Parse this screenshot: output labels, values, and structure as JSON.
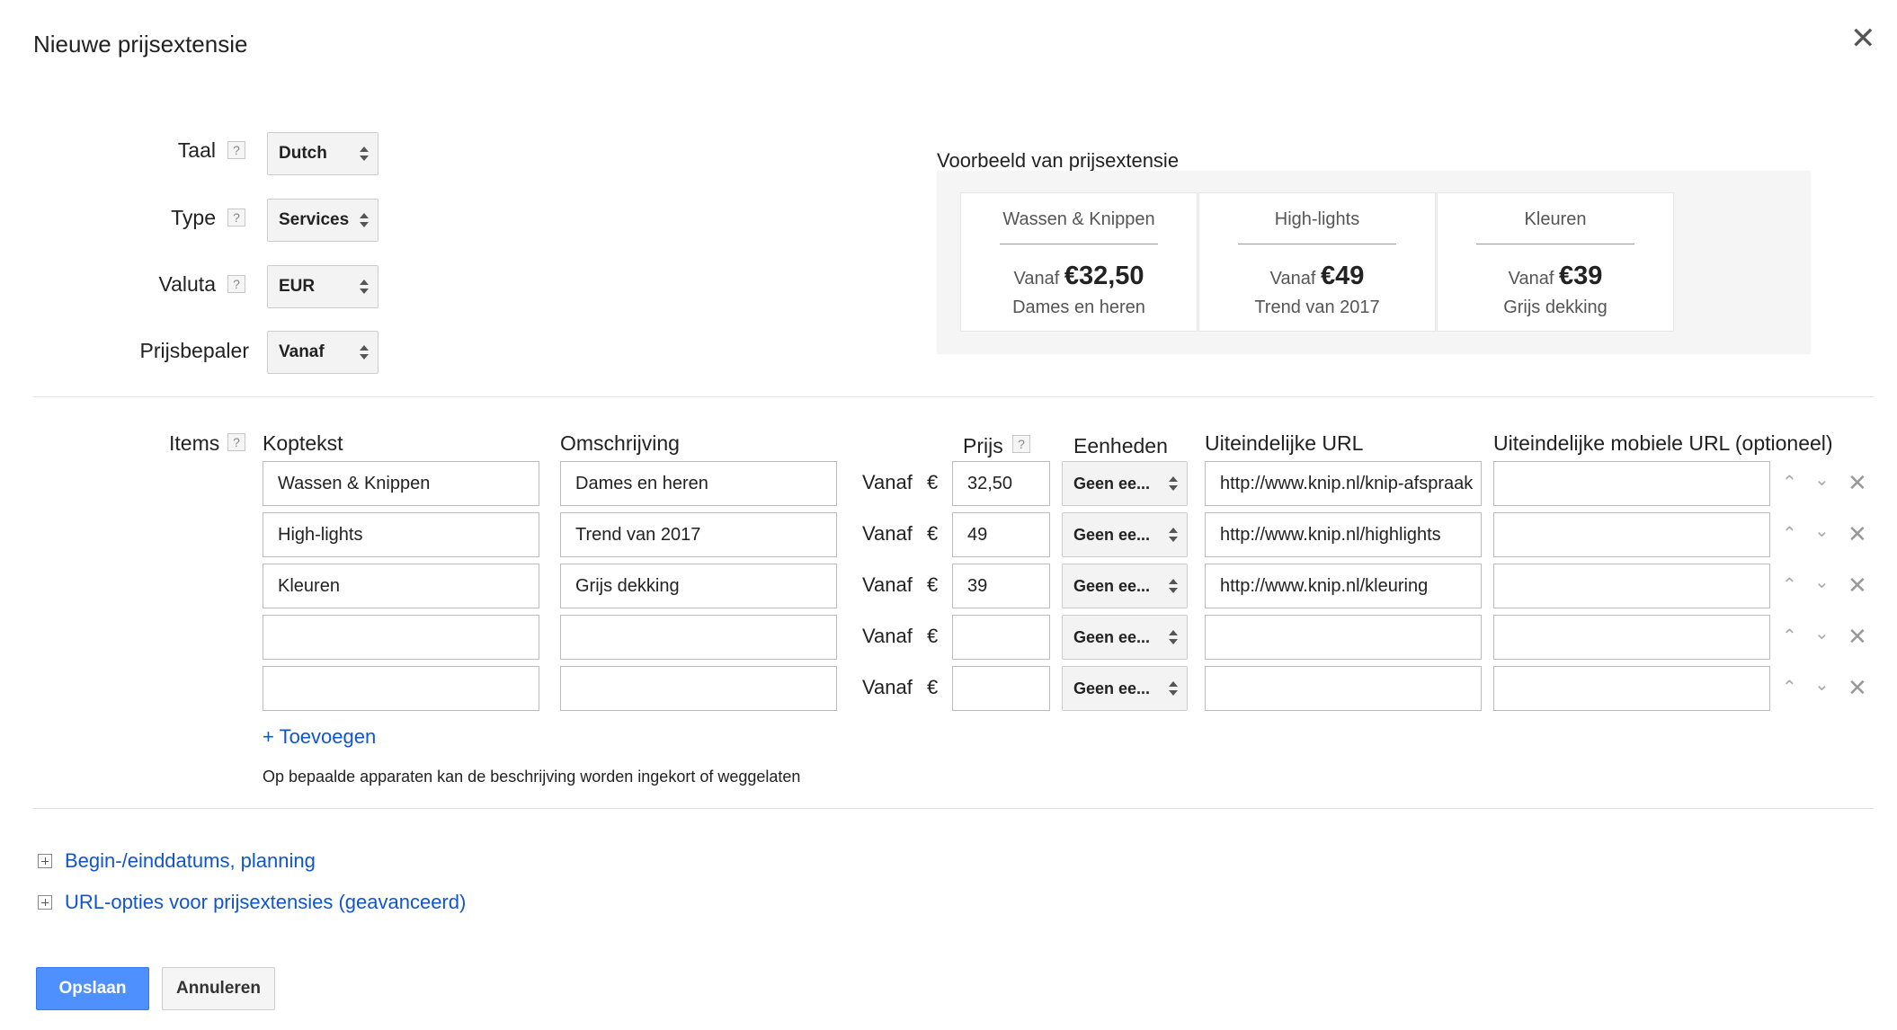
{
  "dialog": {
    "title": "Nieuwe prijsextensie",
    "close_icon": "close-icon"
  },
  "fields": {
    "language": {
      "label": "Taal",
      "value": "Dutch"
    },
    "type": {
      "label": "Type",
      "value": "Services"
    },
    "currency": {
      "label": "Valuta",
      "value": "EUR"
    },
    "price_qualifier": {
      "label": "Prijsbepaler",
      "value": "Vanaf"
    },
    "help": "?"
  },
  "preview": {
    "title": "Voorbeeld van prijsextensie",
    "cards": [
      {
        "header": "Wassen & Knippen",
        "prefix": "Vanaf",
        "price": "€32,50",
        "description": "Dames en heren"
      },
      {
        "header": "High-lights",
        "prefix": "Vanaf",
        "price": "€49",
        "description": "Trend van 2017"
      },
      {
        "header": "Kleuren",
        "prefix": "Vanaf",
        "price": "€39",
        "description": "Grijs dekking"
      }
    ]
  },
  "items": {
    "label": "Items",
    "columns": {
      "header": "Koptekst",
      "description": "Omschrijving",
      "price": "Prijs",
      "units": "Eenheden",
      "final_url": "Uiteindelijke URL",
      "mobile_url": "Uiteindelijke mobiele URL (optioneel)"
    },
    "rows": [
      {
        "header": "Wassen & Knippen",
        "description": "Dames en heren",
        "qualifier": "Vanaf",
        "currency": "€",
        "price": "32,50",
        "unit": "Geen ee...",
        "url": "http://www.knip.nl/knip-afspraak",
        "mobile_url": ""
      },
      {
        "header": "High-lights",
        "description": "Trend van 2017",
        "qualifier": "Vanaf",
        "currency": "€",
        "price": "49",
        "unit": "Geen ee...",
        "url": "http://www.knip.nl/highlights",
        "mobile_url": ""
      },
      {
        "header": "Kleuren",
        "description": "Grijs dekking",
        "qualifier": "Vanaf",
        "currency": "€",
        "price": "39",
        "unit": "Geen ee...",
        "url": "http://www.knip.nl/kleuring",
        "mobile_url": ""
      },
      {
        "header": "",
        "description": "",
        "qualifier": "Vanaf",
        "currency": "€",
        "price": "",
        "unit": "Geen ee...",
        "url": "",
        "mobile_url": ""
      },
      {
        "header": "",
        "description": "",
        "qualifier": "Vanaf",
        "currency": "€",
        "price": "",
        "unit": "Geen ee...",
        "url": "",
        "mobile_url": ""
      }
    ],
    "add_label": "+ Toevoegen",
    "note": "Op bepaalde apparaten kan de beschrijving worden ingekort of weggelaten"
  },
  "sections": {
    "schedule": "Begin-/einddatums, planning",
    "url_options": "URL-opties voor prijsextensies (geavanceerd)"
  },
  "buttons": {
    "save": "Opslaan",
    "cancel": "Annuleren"
  },
  "colors": {
    "accent": "#4d90fe",
    "link": "#1155cc"
  }
}
